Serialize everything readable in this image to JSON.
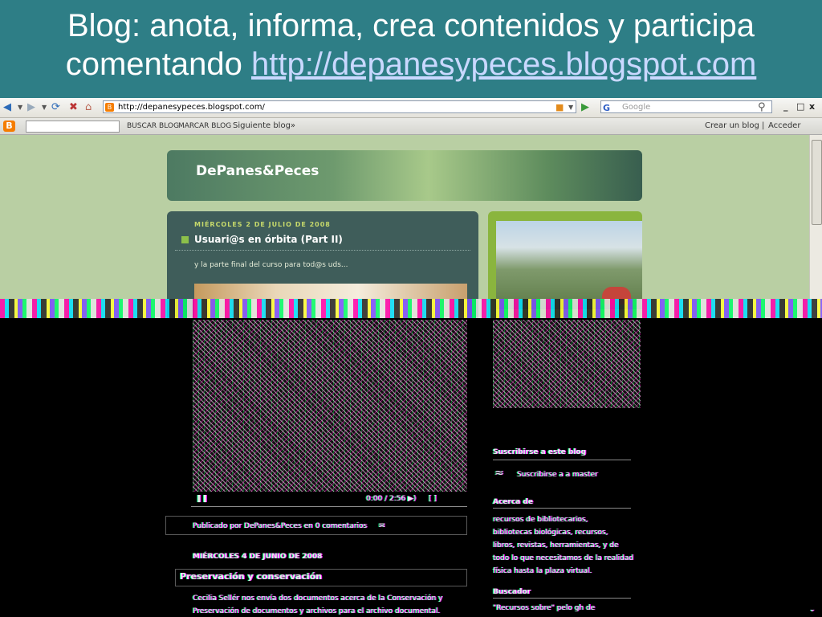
{
  "slide": {
    "title_line1": "Blog: anota, informa, crea contenidos y participa",
    "title_line2_prefix": "comentando ",
    "title_link": "http://depanesypeces.blogspot.com"
  },
  "browser": {
    "address": "http://depanesypeces.blogspot.com/",
    "search_placeholder": "Google",
    "g_label": "G",
    "window_controls": [
      "_",
      "□",
      "x"
    ]
  },
  "blogger_navbar": {
    "logo": "B",
    "buscar_blog": "BUSCAR BLOG",
    "marcar_blog": "MARCAR BLOG",
    "siguiente_blog": "Siguiente blog»",
    "crear_blog": "Crear un blog",
    "separator": "|",
    "acceder": "Acceder"
  },
  "blog": {
    "name": "DePanes&Peces",
    "post1": {
      "date": "MIÉRCOLES 2 DE JULIO DE 2008",
      "title": "Usuari@s en órbita (Part II)",
      "body": "y la parte final del curso para tod@s uds..."
    },
    "post1_footer": "Publicado por DePanes&Peces en 0 comentarios",
    "video_time": "0:00 / 2:56",
    "post2": {
      "date": "MIÉRCOLES 4 DE JUNIO DE 2008",
      "title": "Preservación y conservación",
      "body_line1": "Cecilia Sellér nos envía dos documentos acerca de la Conservación y",
      "body_line2": "Preservación de documentos y archivos para el archivo documental."
    },
    "sidebar": {
      "subscribe_title": "Suscribirse a este blog",
      "subscribe_link": "Suscribirse a a master",
      "about_title": "Acerca de",
      "about_lines": [
        "recursos de bibliotecarios,",
        "bibliotecas biológicas, recursos,",
        "libros, revistas, herramientas, y de",
        "todo lo que necesitamos de la realidad",
        "física hasta la plaza virtual."
      ],
      "buscador_title": "Buscador",
      "buscador_text": "\"Recursos sobre\" pelo gh de"
    }
  }
}
